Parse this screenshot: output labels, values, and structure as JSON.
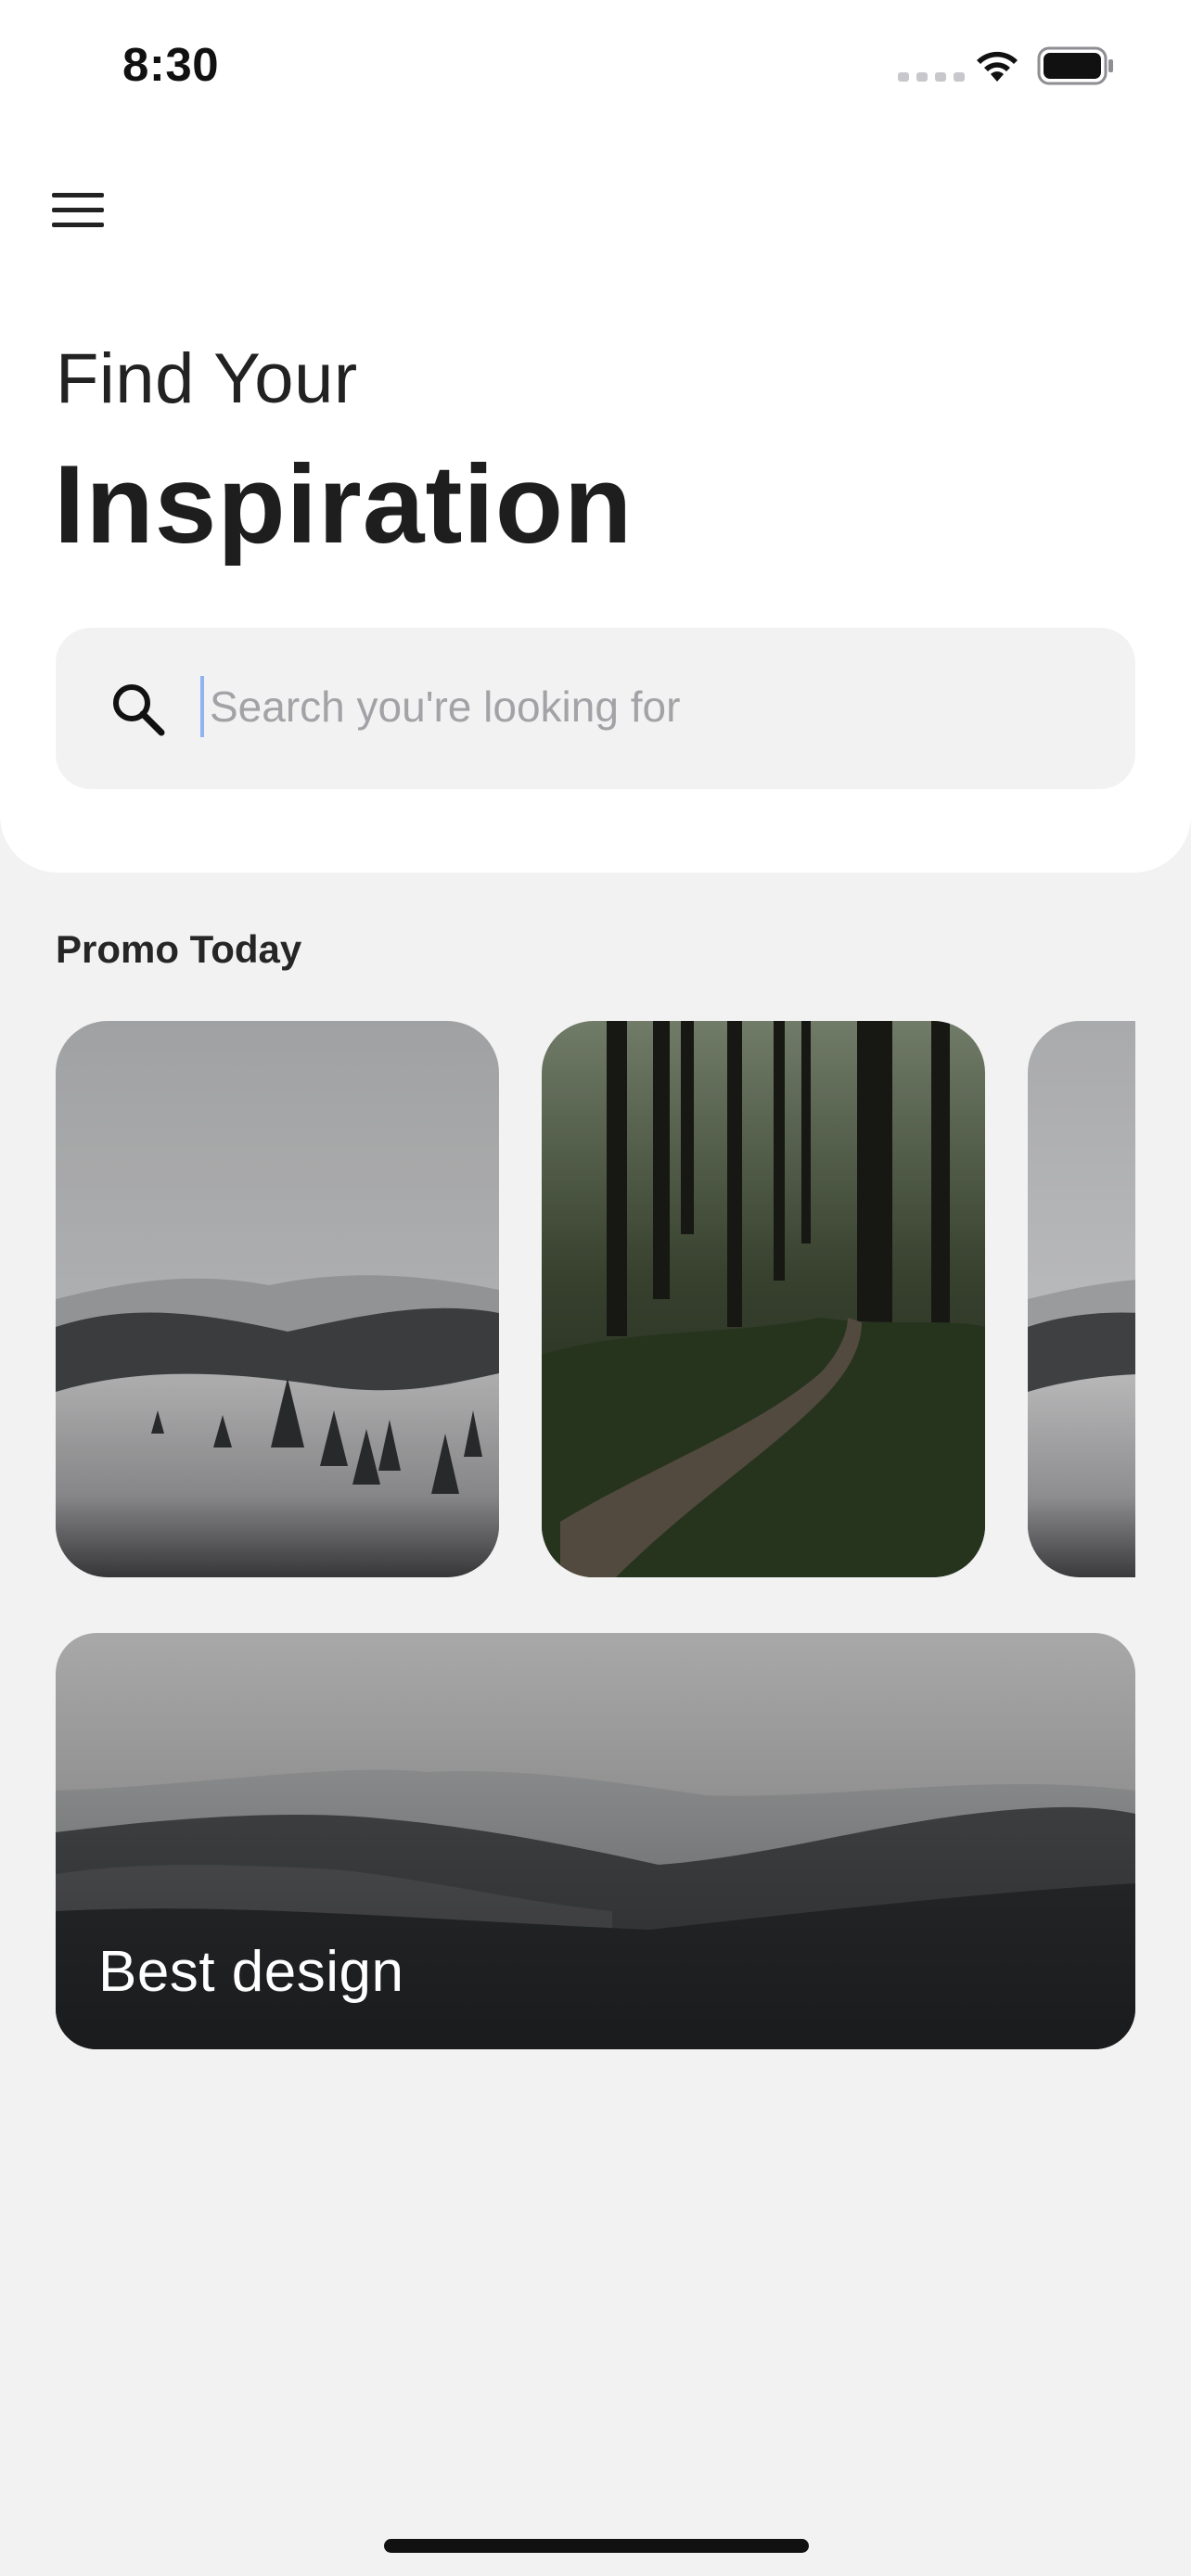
{
  "status_bar": {
    "time": "8:30"
  },
  "header": {
    "greeting": "Find Your",
    "title": "Inspiration"
  },
  "search": {
    "placeholder": "Search you're looking for",
    "value": ""
  },
  "promo": {
    "section_title": "Promo Today",
    "cards": [
      {
        "scene": "snowy-hills"
      },
      {
        "scene": "forest-path"
      },
      {
        "scene": "snowy-hills"
      }
    ]
  },
  "banner": {
    "label": "Best design"
  },
  "icons": {
    "menu": "hamburger-icon",
    "search": "search-icon",
    "wifi": "wifi-icon",
    "battery": "battery-icon"
  }
}
